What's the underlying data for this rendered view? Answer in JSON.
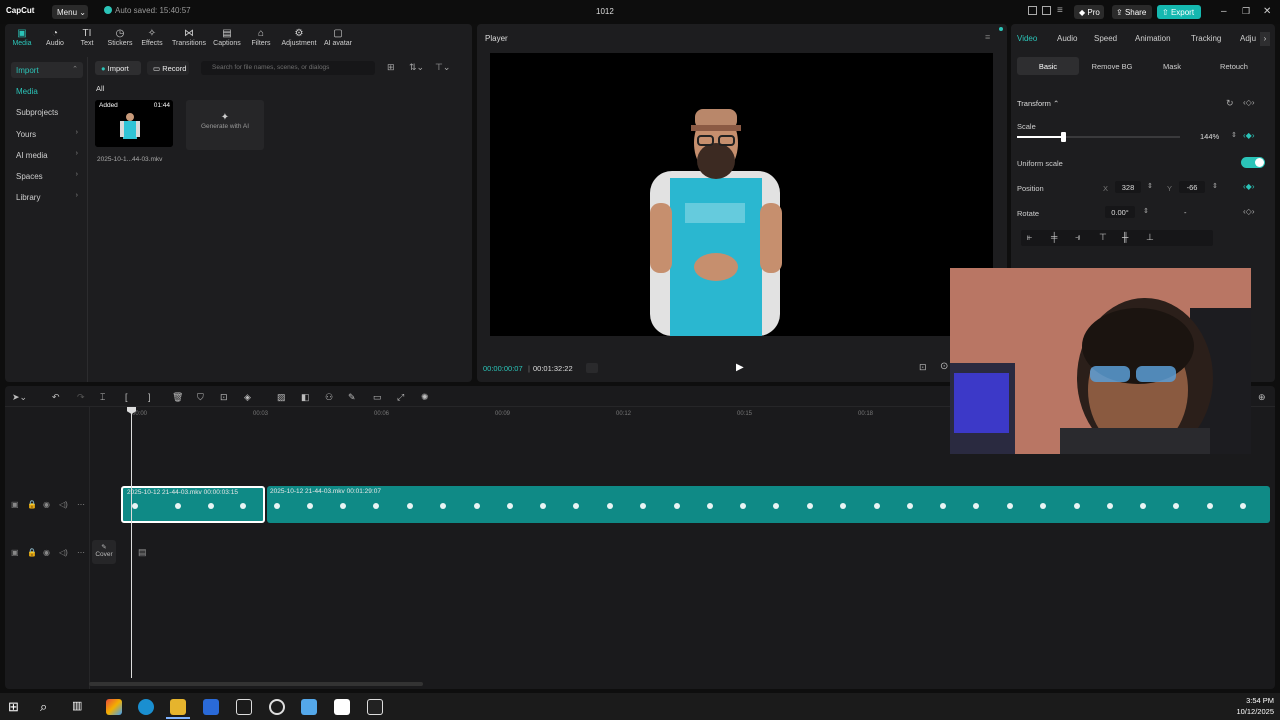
{
  "titlebar": {
    "logo": "CapCut",
    "menu_label": "Menu",
    "autosave": "Auto saved: 15:40:57",
    "project_title": "1012",
    "pro_label": "Pro",
    "share_label": "Share",
    "export_label": "Export"
  },
  "toolbar": {
    "items": [
      "Media",
      "Audio",
      "Text",
      "Stickers",
      "Effects",
      "Transitions",
      "Captions",
      "Filters",
      "Adjustment",
      "AI avatar"
    ],
    "active": "Media"
  },
  "left_nav": {
    "items": [
      "Import",
      "Media",
      "Subprojects",
      "Yours",
      "AI media",
      "Spaces",
      "Library"
    ]
  },
  "media": {
    "import_button": "Import",
    "record_button": "Record",
    "search_placeholder": "Search for file names, scenes, or dialogs",
    "filter_all": "All",
    "clip_badge": "Added",
    "clip_duration": "01:44",
    "clip_name": "2025-10-1...44-03.mkv",
    "generate_label": "Generate with AI"
  },
  "player": {
    "title": "Player",
    "current_time": "00:00:00:07",
    "total_time": "00:01:32:22"
  },
  "props": {
    "tabs": [
      "Video",
      "Audio",
      "Speed",
      "Animation",
      "Tracking",
      "Adju"
    ],
    "active_tab": "Video",
    "subtabs": [
      "Basic",
      "Remove BG",
      "Mask",
      "Retouch"
    ],
    "active_subtab": "Basic",
    "section_transform": "Transform",
    "scale_label": "Scale",
    "scale_value": "144%",
    "scale_fraction": 0.28,
    "uniform_label": "Uniform scale",
    "position_label": "Position",
    "pos_x_label": "X",
    "pos_x": "328",
    "pos_y_label": "Y",
    "pos_y": "-66",
    "rotate_label": "Rotate",
    "rotate_value": "0.00°",
    "rotate_dash": "-"
  },
  "timeline": {
    "ticks": [
      "00:00",
      "00:03",
      "00:06",
      "00:09",
      "00:12",
      "00:15",
      "00:18"
    ],
    "clip1_label": "2025-10-12 21-44-03.mkv   00:00:03:15",
    "clip2_label": "2025-10-12 21-44-03.mkv   00:01:29:07",
    "cover_label": "Cover"
  },
  "taskbar": {
    "time": "3:54 PM",
    "date": "10/12/2025"
  },
  "colors": {
    "accent": "#2bc4b8",
    "export": "#15b8b0",
    "clip": "#0f8a86"
  }
}
